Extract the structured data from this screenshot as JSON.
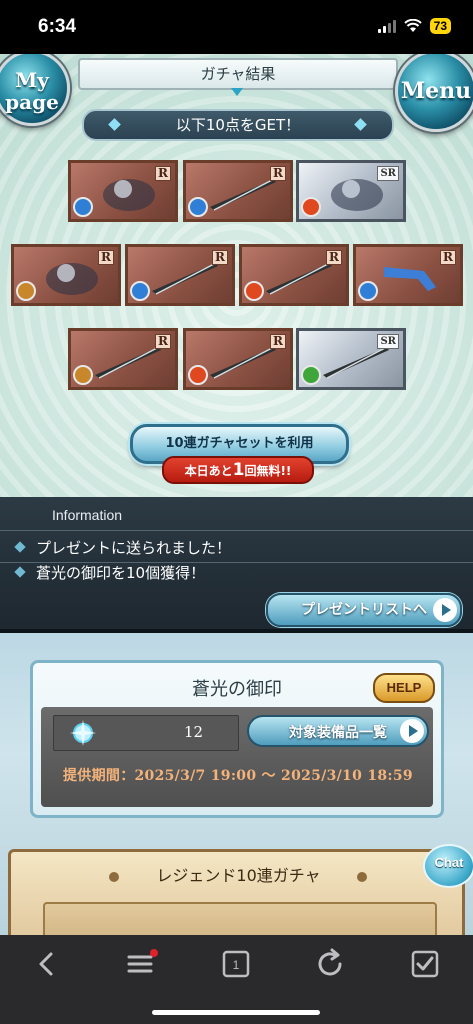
{
  "status": {
    "time": "6:34",
    "battery": "73"
  },
  "header": {
    "mypage_line1": "My",
    "mypage_line2": "page",
    "title": "ガチャ結果",
    "menu": "Menu"
  },
  "result_banner": "以下10点をGET！",
  "items": [
    {
      "rarity": "R",
      "element": "water",
      "kind": "summon-knight"
    },
    {
      "rarity": "R",
      "element": "water",
      "kind": "spear"
    },
    {
      "rarity": "SR",
      "element": "fire",
      "kind": "summon-dragon"
    },
    {
      "rarity": "R",
      "element": "earth",
      "kind": "character-girl"
    },
    {
      "rarity": "R",
      "element": "water",
      "kind": "blade"
    },
    {
      "rarity": "R",
      "element": "fire",
      "kind": "sword"
    },
    {
      "rarity": "R",
      "element": "water",
      "kind": "gauntlet"
    },
    {
      "rarity": "R",
      "element": "earth",
      "kind": "kris"
    },
    {
      "rarity": "R",
      "element": "fire",
      "kind": "longsword"
    },
    {
      "rarity": "SR",
      "element": "wind",
      "kind": "rapier"
    }
  ],
  "gacha_button": "10連ガチャセットを利用",
  "free_badge": {
    "prefix": "本日あと",
    "count": "1",
    "suffix": "回無料!!"
  },
  "information": {
    "heading": "Information",
    "lines": [
      "プレゼントに送られました！",
      "蒼光の御印を10個獲得！"
    ],
    "present_button": "プレゼントリストへ"
  },
  "seal": {
    "title": "蒼光の御印",
    "help": "HELP",
    "count": "12",
    "equip_button": "対象装備品一覧",
    "period": "提供期間：2025/3/7 19:00 〜 2025/3/10 18:59"
  },
  "legend": {
    "title": "レジェンド10連ガチャ"
  },
  "chat": "Chat",
  "colors": {
    "water": "#2f7fd6",
    "fire": "#e0481f",
    "earth": "#c8872a",
    "wind": "#3fa63a"
  },
  "browser_icons": [
    "back-icon",
    "menu-icon",
    "tabs-icon",
    "reload-icon",
    "bookmark-check-icon"
  ],
  "tab_count": "1"
}
